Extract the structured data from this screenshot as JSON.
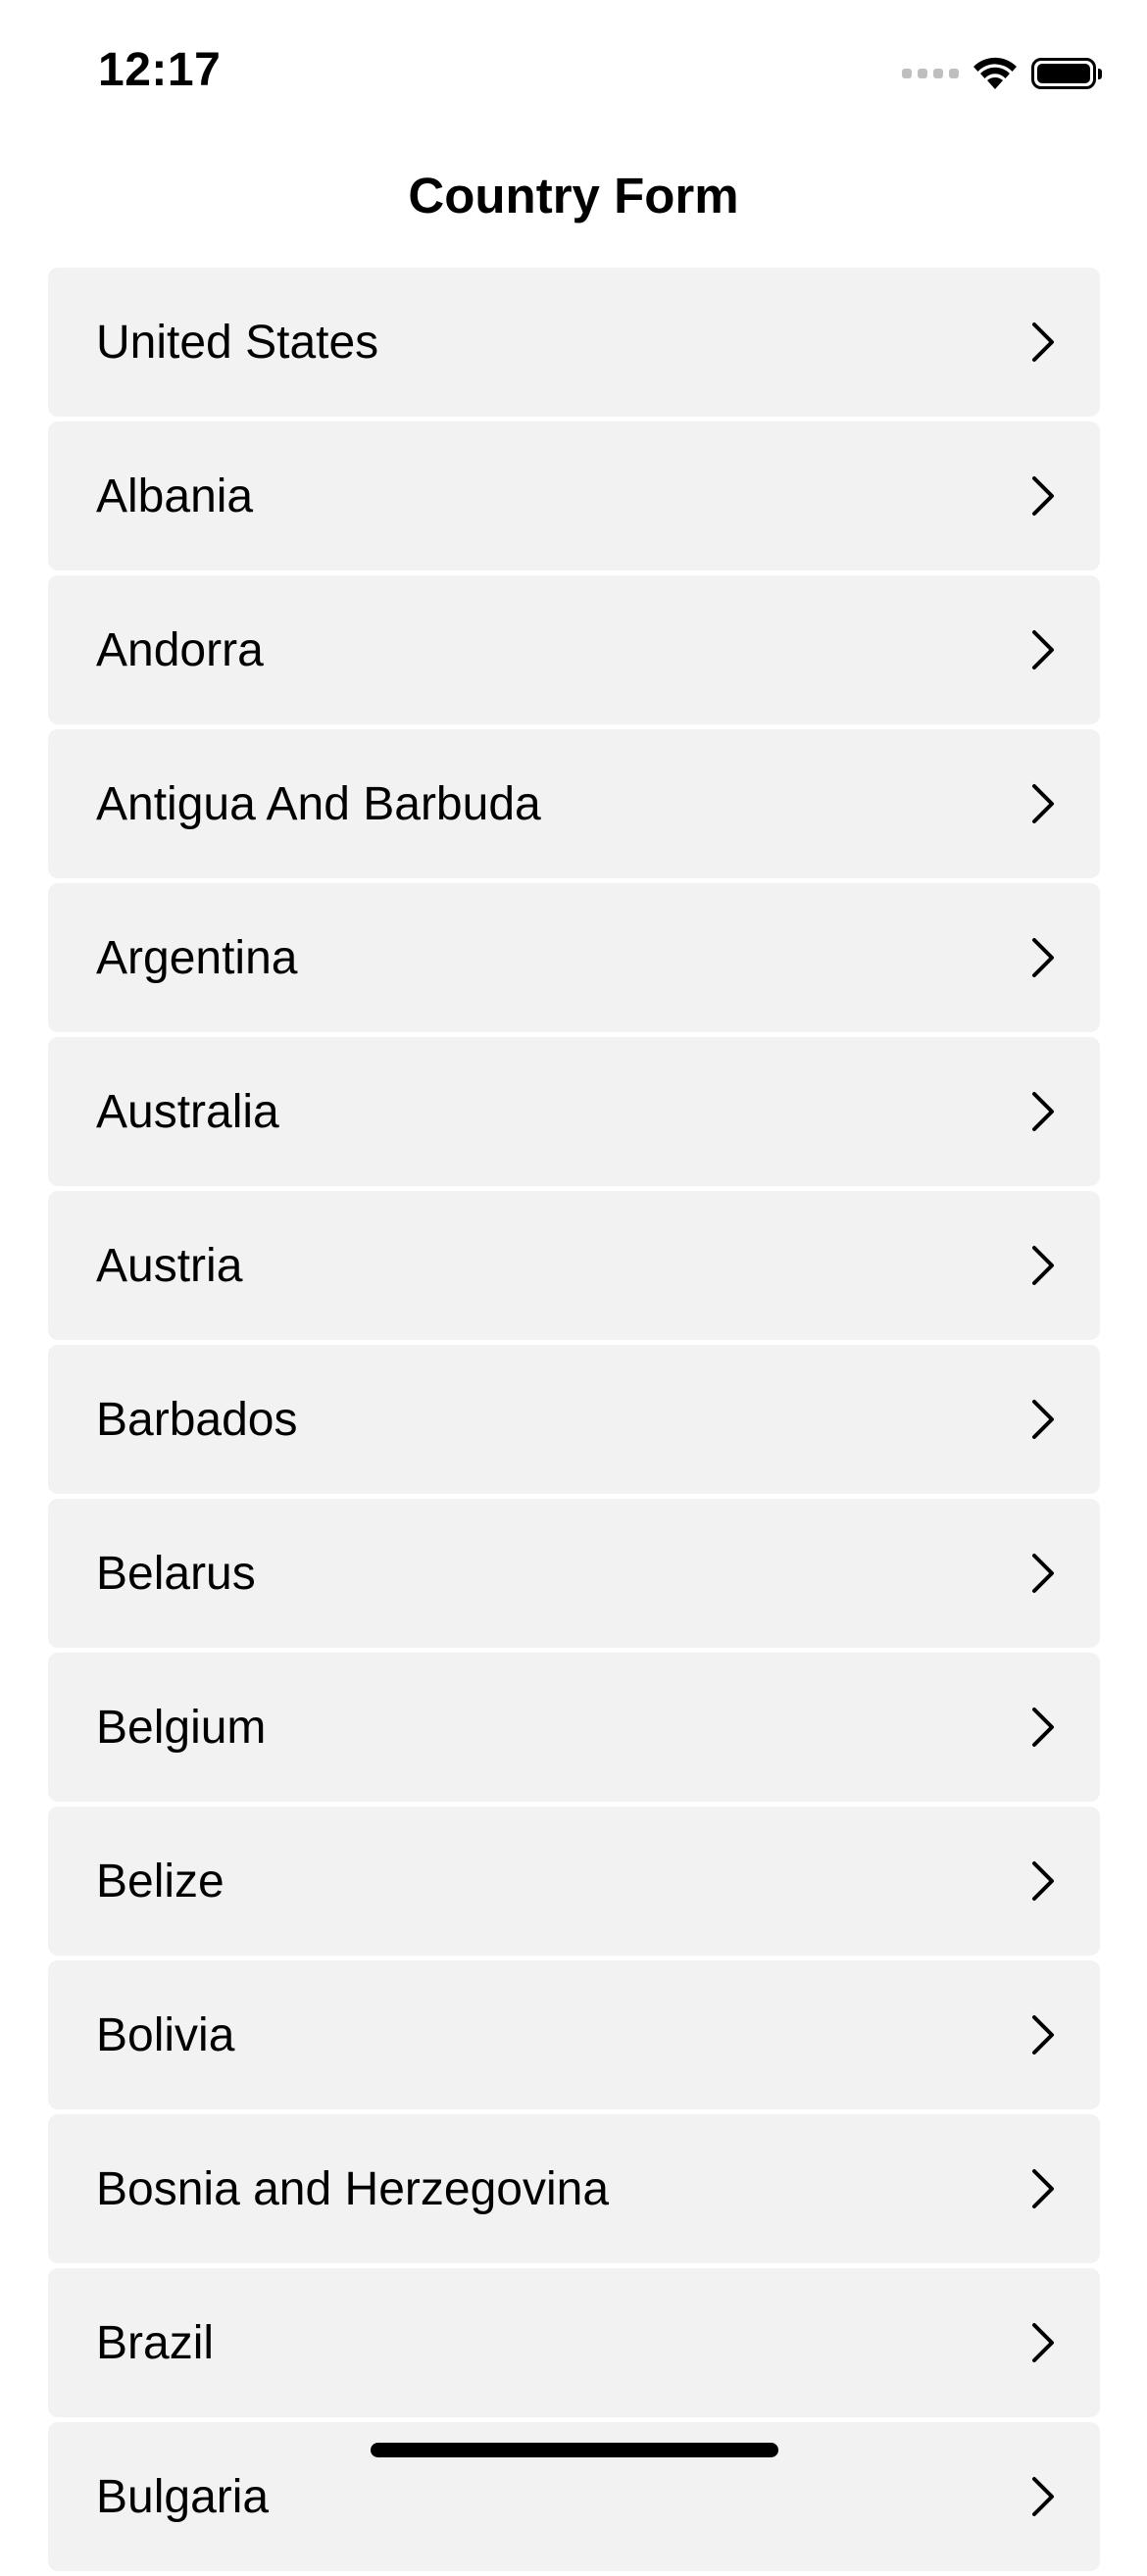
{
  "status_bar": {
    "time": "12:17",
    "icons": [
      "cellular-signal-icon",
      "wifi-icon",
      "battery-icon"
    ]
  },
  "nav": {
    "title": "Country Form"
  },
  "countries": [
    "United States",
    "Albania",
    "Andorra",
    "Antigua And Barbuda",
    "Argentina",
    "Australia",
    "Austria",
    "Barbados",
    "Belarus",
    "Belgium",
    "Belize",
    "Bolivia",
    "Bosnia and Herzegovina",
    "Brazil",
    "Bulgaria"
  ],
  "colors": {
    "row_background": "#f2f2f2",
    "text": "#000000",
    "background": "#ffffff"
  }
}
